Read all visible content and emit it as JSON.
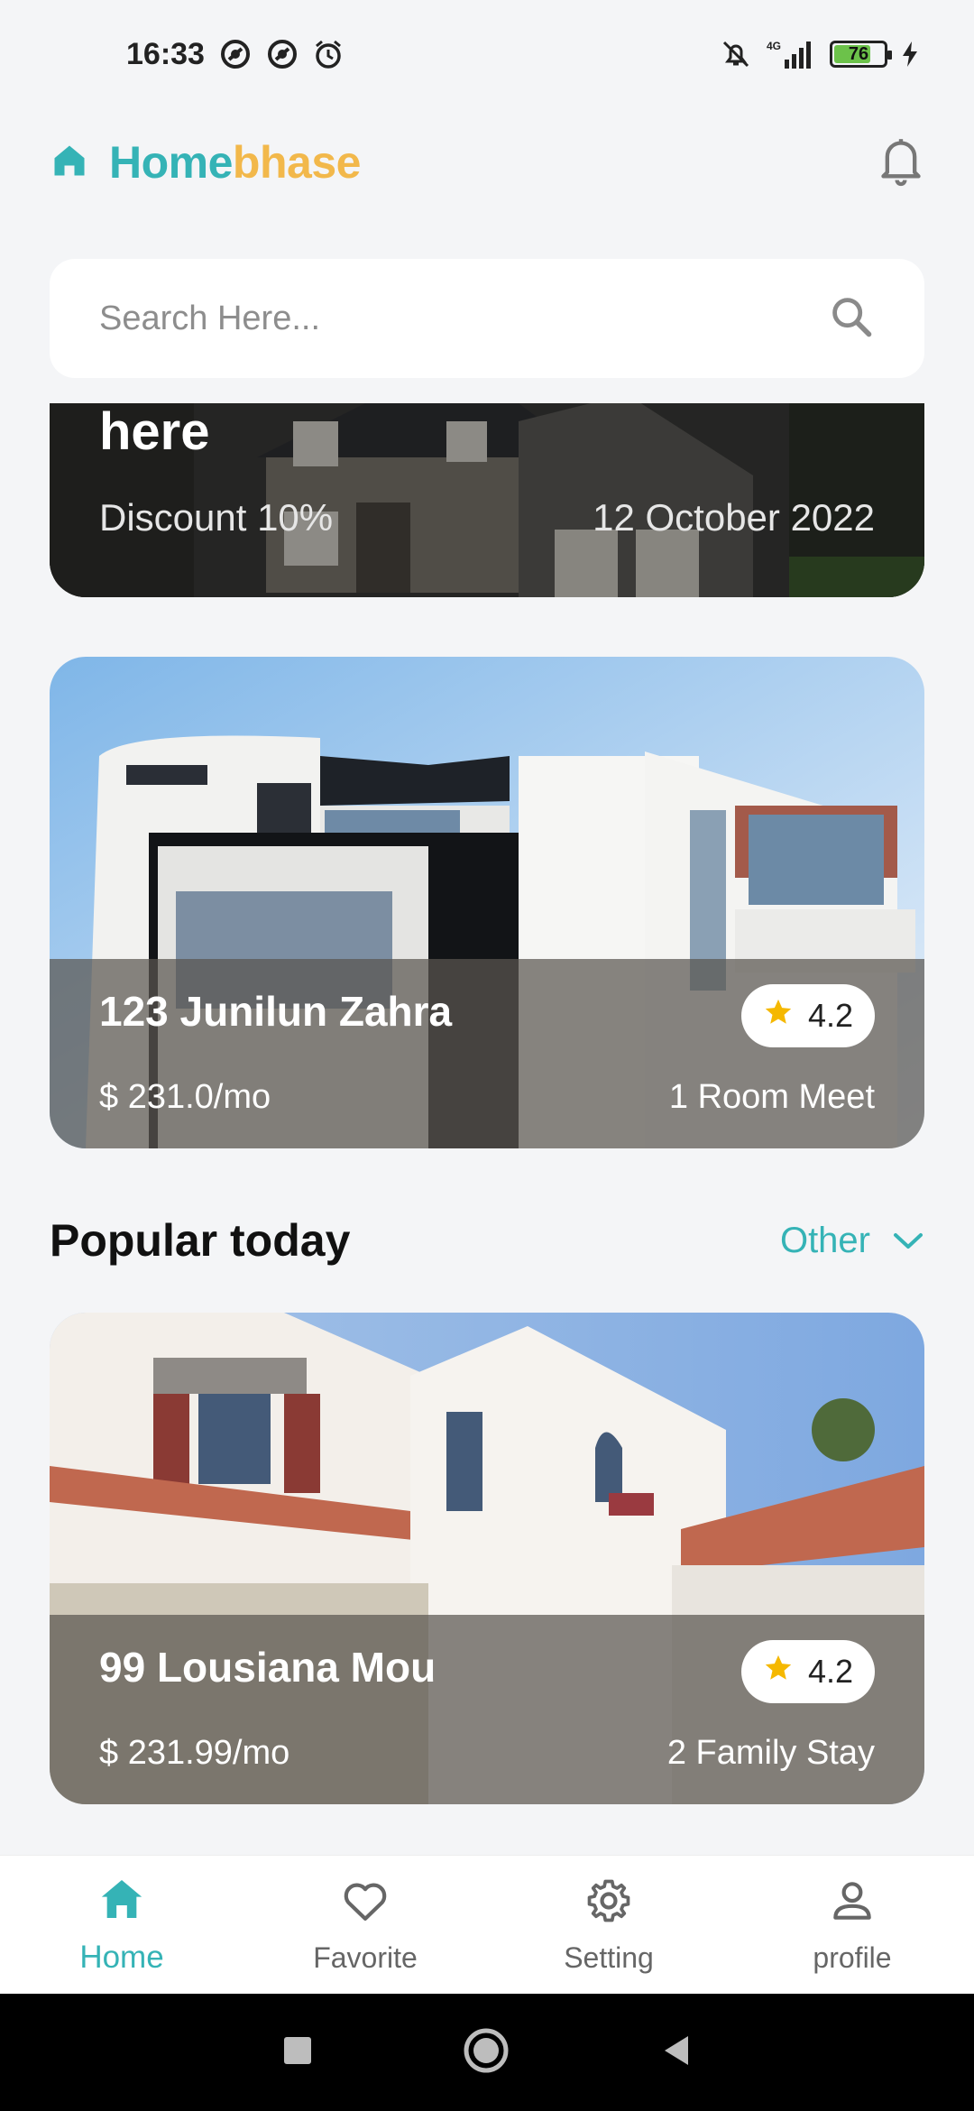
{
  "status_bar": {
    "time": "16:33",
    "battery_level": "76",
    "network": "4G",
    "icons": [
      "vpn-icon",
      "vpn-icon",
      "alarm-icon",
      "mute-icon",
      "signal-icon",
      "battery-icon",
      "charging-icon"
    ]
  },
  "header": {
    "brand_part1": "Home",
    "brand_part2": "bhase",
    "brand_color_1": "#35b3b6",
    "brand_color_2": "#f2b84b",
    "icons": [
      "home-icon",
      "bell-icon"
    ]
  },
  "search": {
    "placeholder": "Search Here...",
    "value": ""
  },
  "promo": {
    "title": "here",
    "discount": "Discount 10%",
    "date": "12 October 2022"
  },
  "featured": {
    "title": "123 Junilun Zahra",
    "rating": "4.2",
    "price": "$ 231.0/mo",
    "meta": "1 Room Meet"
  },
  "popular": {
    "section_title": "Popular today",
    "filter_label": "Other",
    "items": [
      {
        "title": "99 Lousiana Mou",
        "rating": "4.2",
        "price": "$ 231.99/mo",
        "meta": "2 Family Stay"
      }
    ]
  },
  "bottom_nav": {
    "items": [
      {
        "label": "Home",
        "icon": "home-icon",
        "active": true
      },
      {
        "label": "Favorite",
        "icon": "heart-icon",
        "active": false
      },
      {
        "label": "Setting",
        "icon": "gear-icon",
        "active": false
      },
      {
        "label": "profile",
        "icon": "user-icon",
        "active": false
      }
    ]
  },
  "colors": {
    "accent": "#35b3b6",
    "brand_secondary": "#f2b84b",
    "star": "#f5b800",
    "background": "#f4f5f7"
  }
}
